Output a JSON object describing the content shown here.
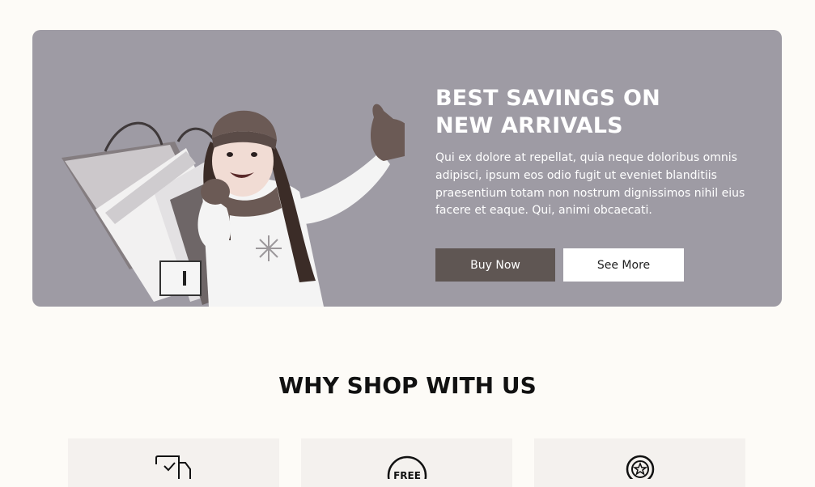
{
  "hero": {
    "headline_line1": "BEST SAVINGS ON",
    "headline_line2": "NEW ARRIVALS",
    "description": "Qui ex dolore at repellat, quia neque doloribus omnis adipisci, ipsum eos odio fugit ut eveniet blanditiis praesentium totam non nostrum dignissimos nihil eius facere et eaque. Qui, animi obcaecati.",
    "buy_label": "Buy Now",
    "more_label": "See More",
    "colors": {
      "banner_bg": "#9e9ba4",
      "primary_button": "#5f5653",
      "secondary_button": "#ffffff"
    }
  },
  "why": {
    "title": "WHY SHOP WITH US",
    "cards": [
      {
        "icon": "delivery-truck-icon"
      },
      {
        "icon": "free-badge-icon",
        "icon_text": "FREE"
      },
      {
        "icon": "star-badge-icon"
      }
    ]
  },
  "page": {
    "background": "#fdfbf7",
    "card_background": "#f4f1ee"
  }
}
